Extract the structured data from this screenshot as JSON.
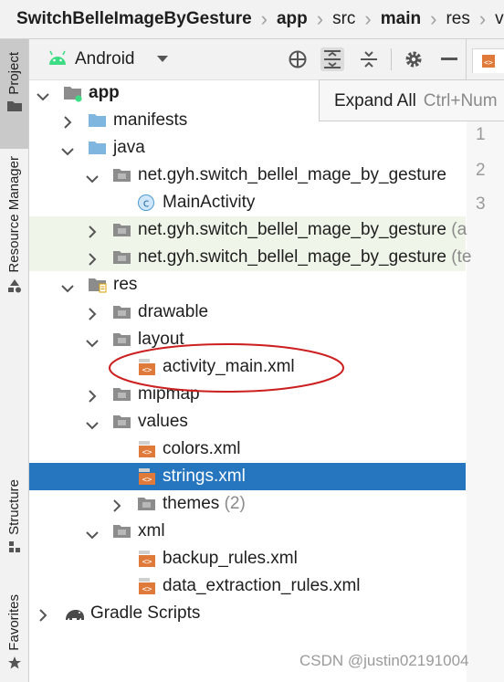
{
  "breadcrumb": [
    "SwitchBelleImageByGesture",
    "app",
    "src",
    "main",
    "res",
    "valu"
  ],
  "tool_windows": {
    "project": "Project",
    "resource_manager": "Resource Manager",
    "structure": "Structure",
    "favorites": "Favorites"
  },
  "project_toolbar": {
    "view_mode": "Android"
  },
  "tooltip": {
    "text": "Expand All",
    "shortcut": "Ctrl+Num"
  },
  "editor": {
    "line_numbers": [
      "1",
      "2",
      "3"
    ]
  },
  "tree": [
    {
      "label": "app",
      "bold": true,
      "type": "module",
      "expanded": true
    },
    {
      "label": "manifests",
      "type": "folder",
      "expanded": false
    },
    {
      "label": "java",
      "type": "folder",
      "expanded": true
    },
    {
      "label": "net.gyh.switch_bellel_mage_by_gesture",
      "type": "package",
      "expanded": true
    },
    {
      "label": "MainActivity",
      "type": "class"
    },
    {
      "label": "net.gyh.switch_bellel_mage_by_gesture",
      "suffix": "(a",
      "type": "package",
      "expanded": false,
      "highlighted": true
    },
    {
      "label": "net.gyh.switch_bellel_mage_by_gesture",
      "suffix": "(te",
      "type": "package",
      "expanded": false,
      "highlighted": true
    },
    {
      "label": "res",
      "type": "res-folder",
      "expanded": true
    },
    {
      "label": "drawable",
      "type": "package",
      "expanded": false
    },
    {
      "label": "layout",
      "type": "package",
      "expanded": true
    },
    {
      "label": "activity_main.xml",
      "type": "xml",
      "circled": true
    },
    {
      "label": "mipmap",
      "type": "package",
      "expanded": false
    },
    {
      "label": "values",
      "type": "package",
      "expanded": true
    },
    {
      "label": "colors.xml",
      "type": "xml"
    },
    {
      "label": "strings.xml",
      "type": "xml",
      "selected": true
    },
    {
      "label": "themes",
      "suffix": "(2)",
      "type": "package",
      "expanded": false
    },
    {
      "label": "xml",
      "type": "package",
      "expanded": true
    },
    {
      "label": "backup_rules.xml",
      "type": "xml"
    },
    {
      "label": "data_extraction_rules.xml",
      "type": "xml"
    },
    {
      "label": "Gradle Scripts",
      "type": "gradle",
      "expanded": false
    }
  ],
  "watermark": "CSDN @justin02191004",
  "colors": {
    "selection": "#2675bf",
    "test_highlight": "#eff5e9",
    "annotation": "#cc1f1f",
    "folder_blue": "#7eb6e0",
    "package_gray": "#8c8c8c",
    "xml_orange": "#e07a3a",
    "android_green": "#3ddc84"
  }
}
